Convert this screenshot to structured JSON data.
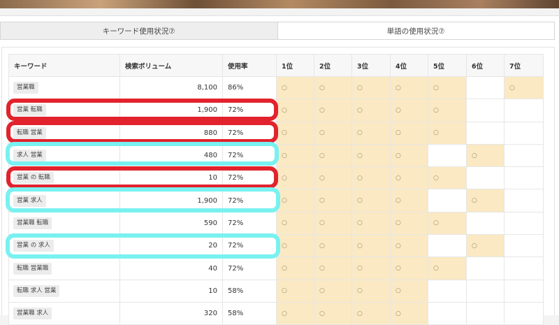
{
  "tabs": [
    {
      "label": "キーワード使用状況⑦",
      "active": true
    },
    {
      "label": "単語の使用状況⑦",
      "active": false
    }
  ],
  "table": {
    "headers": [
      "キーワード",
      "検索ボリューム",
      "使用率",
      "1位",
      "2位",
      "3位",
      "4位",
      "5位",
      "6位",
      "7位"
    ],
    "rows": [
      {
        "keyword": "営業職",
        "volume": "8,100",
        "rate": "86%",
        "ranks": [
          "○",
          "○",
          "○",
          "○",
          "○",
          "",
          "○"
        ]
      },
      {
        "keyword": "営業 転職",
        "volume": "1,900",
        "rate": "72%",
        "ranks": [
          "○",
          "○",
          "○",
          "○",
          "○",
          "",
          ""
        ]
      },
      {
        "keyword": "転職 営業",
        "volume": "880",
        "rate": "72%",
        "ranks": [
          "○",
          "○",
          "○",
          "○",
          "○",
          "",
          ""
        ]
      },
      {
        "keyword": "求人 営業",
        "volume": "480",
        "rate": "72%",
        "ranks": [
          "○",
          "○",
          "○",
          "○",
          "",
          "○",
          ""
        ]
      },
      {
        "keyword": "営業 の 転職",
        "volume": "10",
        "rate": "72%",
        "ranks": [
          "○",
          "○",
          "○",
          "○",
          "○",
          "",
          ""
        ]
      },
      {
        "keyword": "営業 求人",
        "volume": "1,900",
        "rate": "72%",
        "ranks": [
          "○",
          "○",
          "○",
          "○",
          "",
          "○",
          ""
        ]
      },
      {
        "keyword": "営業職 転職",
        "volume": "590",
        "rate": "72%",
        "ranks": [
          "○",
          "○",
          "○",
          "○",
          "○",
          "",
          ""
        ]
      },
      {
        "keyword": "営業 の 求人",
        "volume": "20",
        "rate": "72%",
        "ranks": [
          "○",
          "○",
          "○",
          "○",
          "",
          "○",
          ""
        ]
      },
      {
        "keyword": "転職 営業職",
        "volume": "40",
        "rate": "72%",
        "ranks": [
          "○",
          "○",
          "○",
          "○",
          "○",
          "",
          ""
        ]
      },
      {
        "keyword": "転職 求人 営業",
        "volume": "10",
        "rate": "58%",
        "ranks": [
          "○",
          "○",
          "○",
          "○",
          "",
          "",
          ""
        ]
      },
      {
        "keyword": "営業職 求人",
        "volume": "320",
        "rate": "58%",
        "ranks": [
          "○",
          "○",
          "○",
          "○",
          "",
          "",
          ""
        ]
      }
    ]
  },
  "highlights": {
    "red_color": "#e2222c",
    "cyan_color": "#79f1f1",
    "red_rows": [
      "営業 転職",
      "転職 営業",
      "営業 の 転職"
    ],
    "cyan_rows": [
      "求人 営業",
      "営業 求人",
      "営業 の 求人"
    ]
  }
}
